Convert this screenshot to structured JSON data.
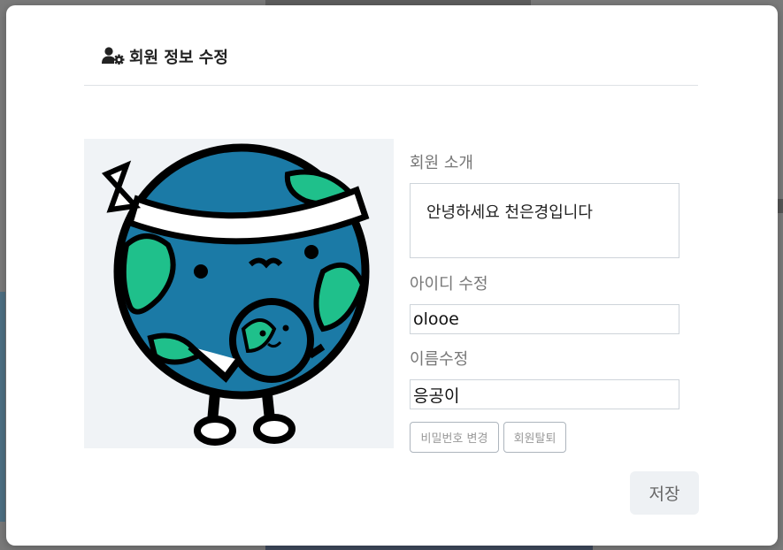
{
  "modal": {
    "title": "회원 정보 수정",
    "header_icon": "user-gear-icon"
  },
  "avatar": {
    "description_icon": "earth-character-icon"
  },
  "fields": {
    "bio_label": "회원 소개",
    "bio_value": "안녕하세요 천은경입니다",
    "id_label": "아이디 수정",
    "id_value": "olooe",
    "name_label": "이름수정",
    "name_value": "응공이"
  },
  "buttons": {
    "change_password": "비밀번호 변경",
    "withdraw": "회원탈퇴",
    "save": "저장"
  },
  "colors": {
    "earth_blue": "#1b7aa6",
    "earth_green": "#1fc08b",
    "label_gray": "#777777",
    "save_bg": "#eef1f4"
  }
}
